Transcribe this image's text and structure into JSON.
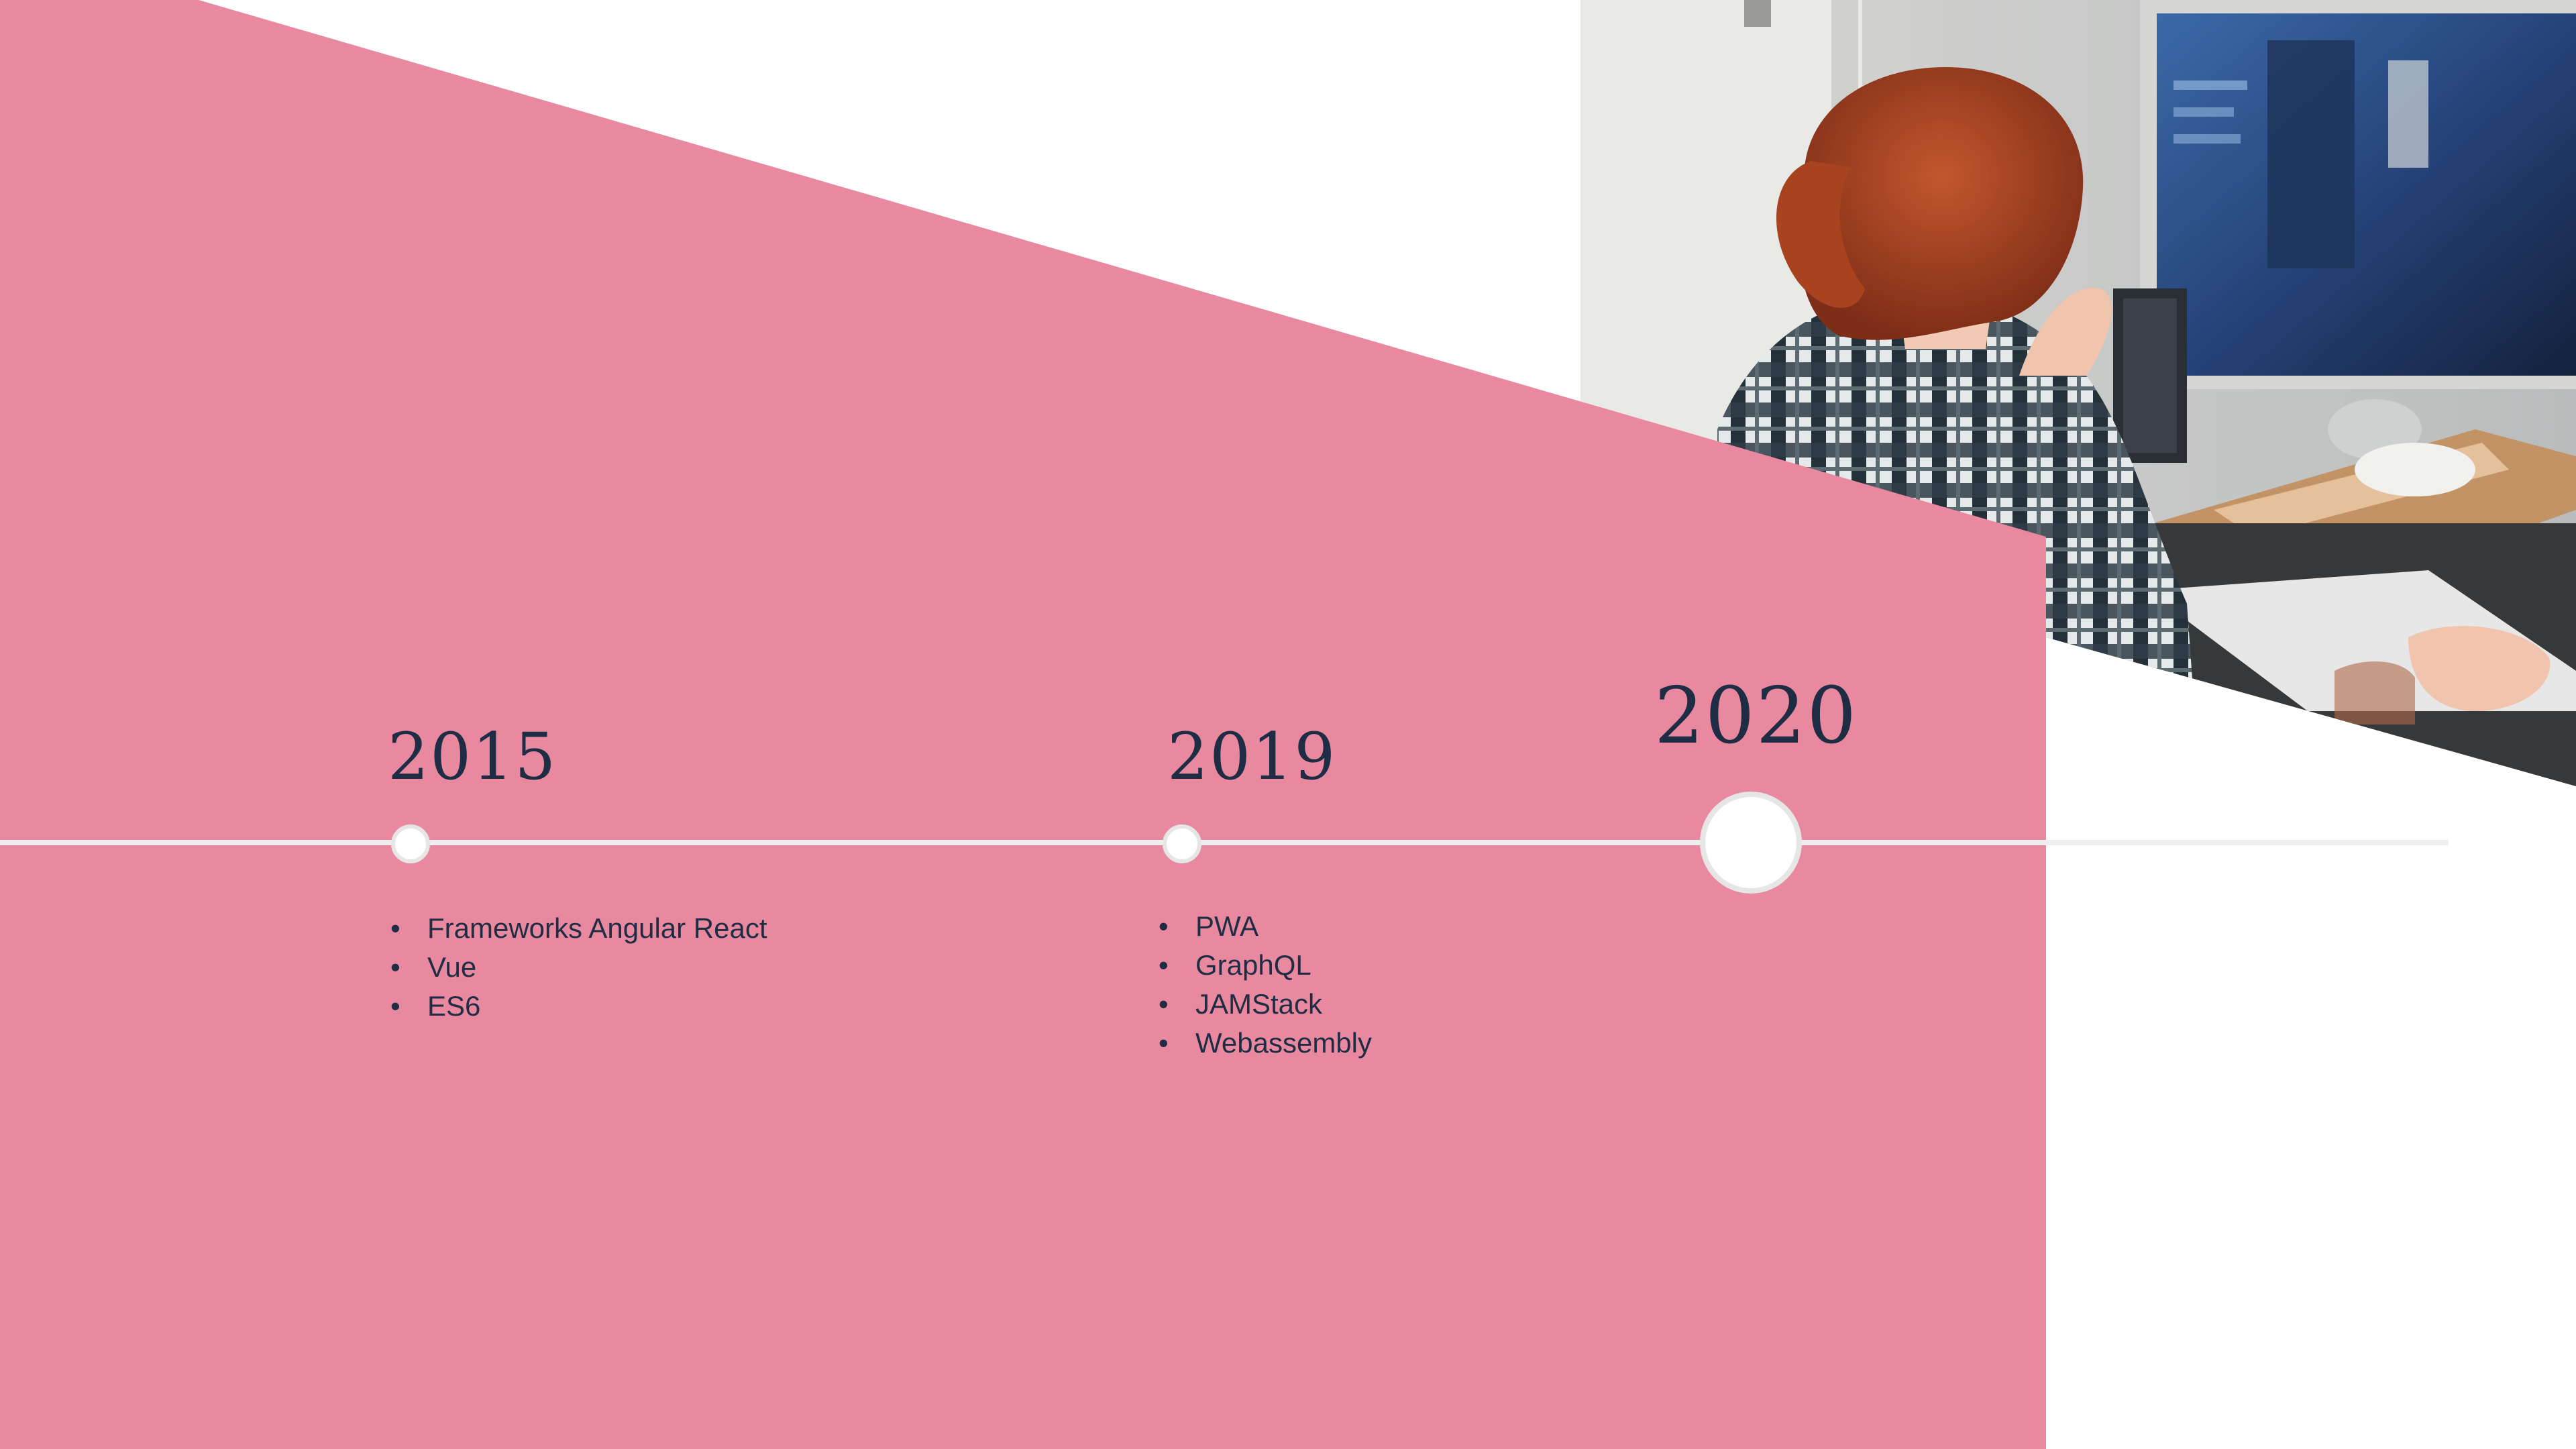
{
  "slide": {
    "colors": {
      "accent_pink": "#E8899F",
      "text_navy": "#1F2D44",
      "timeline_line": "#EFEFEF",
      "marker_fill": "#FFFFFF",
      "marker_ring": "#E6E6E6"
    },
    "photo": {
      "description_icon": "person-at-computer-photo"
    },
    "timeline": {
      "milestones": [
        {
          "year": "2015",
          "items": [
            "Frameworks Angular React",
            "Vue",
            "ES6"
          ]
        },
        {
          "year": "2019",
          "items": [
            "PWA",
            "GraphQL",
            "JAMStack",
            "Webassembly"
          ]
        },
        {
          "year": "2020",
          "items": []
        }
      ]
    }
  }
}
